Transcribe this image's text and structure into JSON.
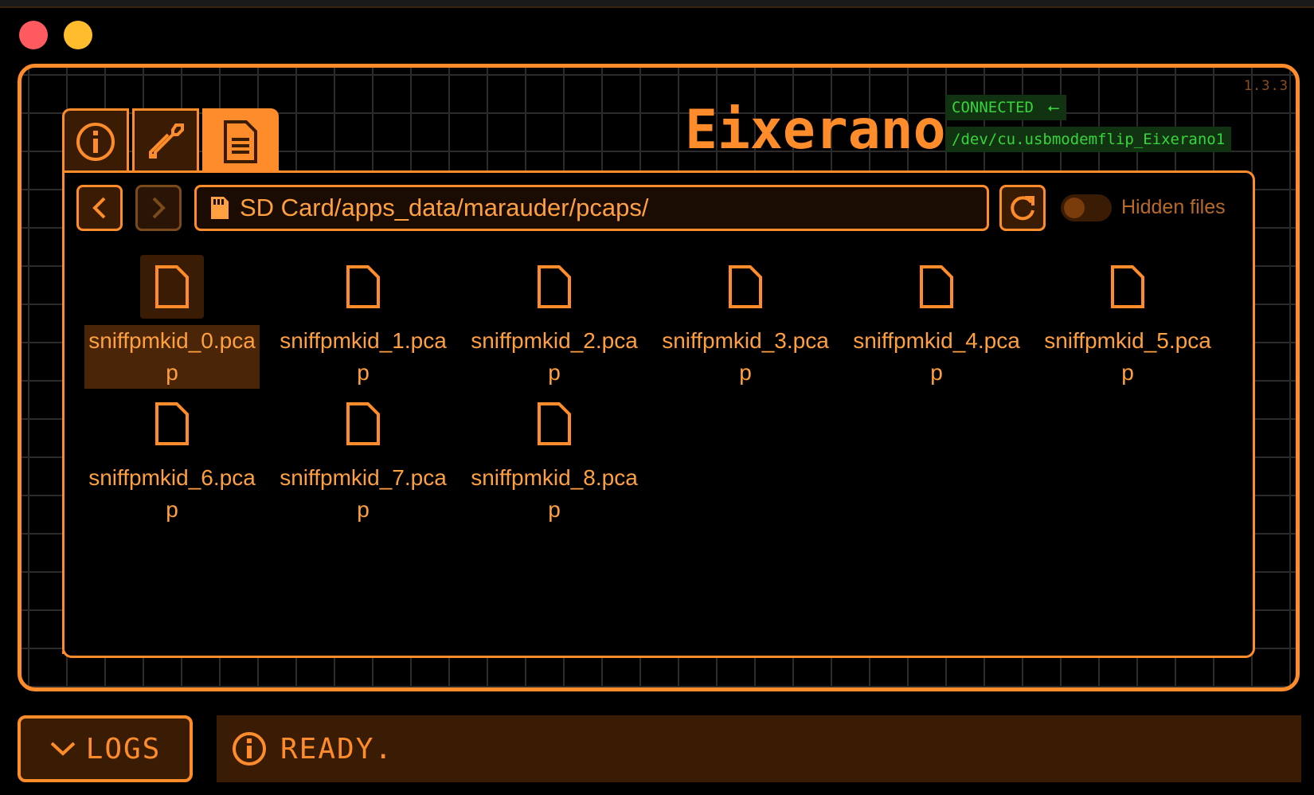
{
  "app": {
    "device_name": "Eixerano",
    "version": "1.3.3",
    "connection_status": "CONNECTED",
    "device_path": "/dev/cu.usbmodemflip_Eixerano1",
    "accent_color": "#ff8c2a",
    "connected_color": "#37d43a"
  },
  "tabs": [
    {
      "name": "info",
      "icon": "info-icon"
    },
    {
      "name": "tools",
      "icon": "wrench-icon"
    },
    {
      "name": "files",
      "icon": "document-icon",
      "active": true
    }
  ],
  "browser": {
    "path": "SD Card/apps_data/marauder/pcaps/",
    "hidden_files_label": "Hidden files",
    "hidden_files_enabled": false,
    "files": [
      {
        "name": "sniffpmkid_0.pcap",
        "selected": true
      },
      {
        "name": "sniffpmkid_1.pcap"
      },
      {
        "name": "sniffpmkid_2.pcap"
      },
      {
        "name": "sniffpmkid_3.pcap"
      },
      {
        "name": "sniffpmkid_4.pcap"
      },
      {
        "name": "sniffpmkid_5.pcap"
      },
      {
        "name": "sniffpmkid_6.pcap"
      },
      {
        "name": "sniffpmkid_7.pcap"
      },
      {
        "name": "sniffpmkid_8.pcap"
      }
    ]
  },
  "footer": {
    "logs_label": "LOGS",
    "status_text": "READY."
  }
}
